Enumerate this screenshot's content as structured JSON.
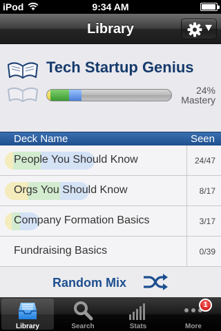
{
  "status": {
    "carrier": "iPod",
    "time": "9:34 AM"
  },
  "navbar": {
    "title": "Library"
  },
  "deck": {
    "title": "Tech Startup Genius",
    "mastery_percent": "24%",
    "mastery_label": "Mastery",
    "progress": {
      "yellow": 0.03,
      "green": 0.15,
      "blue": 0.1
    }
  },
  "table": {
    "header": {
      "name": "Deck Name",
      "seen": "Seen"
    },
    "rows": [
      {
        "name": "People You Should Know",
        "seen": "24/47"
      },
      {
        "name": "Orgs You Should Know",
        "seen": "8/17"
      },
      {
        "name": "Company Formation Basics",
        "seen": "3/17"
      },
      {
        "name": "Fundraising Basics",
        "seen": "0/39"
      }
    ]
  },
  "random_mix": {
    "label": "Random Mix"
  },
  "tabs": [
    {
      "label": "Library",
      "icon": "inbox-tray-icon",
      "active": true
    },
    {
      "label": "Search",
      "icon": "magnifier-icon",
      "active": false
    },
    {
      "label": "Stats",
      "icon": "bar-chart-icon",
      "active": false
    },
    {
      "label": "More",
      "icon": "ellipsis-icon",
      "active": false,
      "badge": "1"
    }
  ],
  "colors": {
    "accent": "#1d4f8f",
    "title": "#153a6b",
    "header_bar": "#1f4f8e",
    "badge": "#c10000"
  }
}
